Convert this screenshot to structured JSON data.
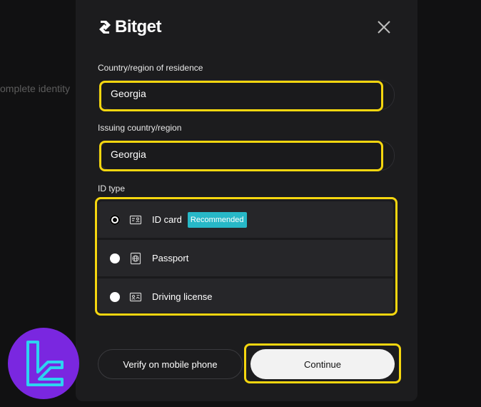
{
  "background": {
    "partial_text": "omplete identity"
  },
  "modal": {
    "brand": "Bitget",
    "residence": {
      "label": "Country/region of residence",
      "value": "Georgia"
    },
    "issuing": {
      "label": "Issuing country/region",
      "value": "Georgia"
    },
    "id_type": {
      "label": "ID type",
      "options": [
        {
          "label": "ID card",
          "badge": "Recommended",
          "icon": "id-card-icon",
          "selected": true
        },
        {
          "label": "Passport",
          "icon": "passport-icon",
          "selected": false
        },
        {
          "label": "Driving license",
          "icon": "driving-license-icon",
          "selected": false
        }
      ]
    },
    "buttons": {
      "mobile": "Verify on mobile phone",
      "continue": "Continue"
    }
  },
  "colors": {
    "highlight": "#f5d60f",
    "badge": "#27b8c7",
    "watermark": "#7a27e0",
    "watermark_glyph": "#2dd3f0"
  }
}
